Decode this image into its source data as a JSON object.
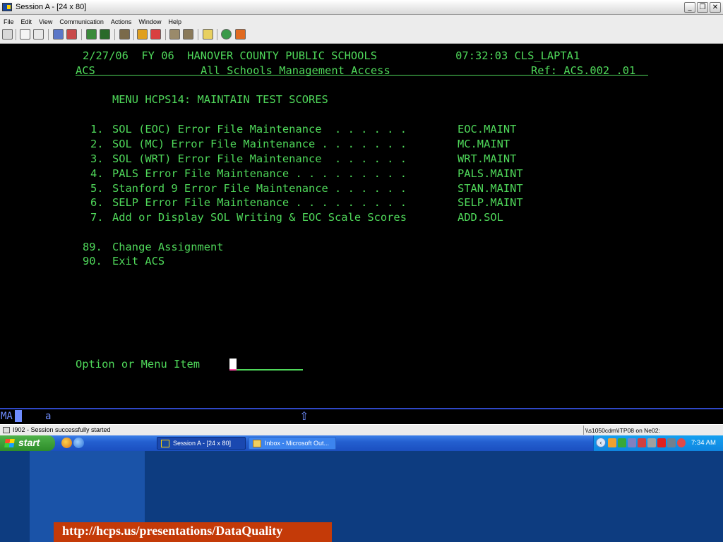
{
  "window": {
    "title": "Session A - [24 x 80]",
    "buttons": [
      "_",
      "❐",
      "✕"
    ]
  },
  "menubar": [
    "File",
    "Edit",
    "View",
    "Communication",
    "Actions",
    "Window",
    "Help"
  ],
  "terminal": {
    "header": {
      "line1": "2/27/06  FY 06  HANOVER COUNTY PUBLIC SCHOOLS            07:32:03 CLS_LAPTA1",
      "app": "ACS",
      "subtitle": "All Schools Management Access",
      "ref": "Ref: ACS.002 .01"
    },
    "menu_title": "MENU HCPS14: MAINTAIN TEST SCORES",
    "items": [
      {
        "num": "1.",
        "label": "SOL (EOC) Error File Maintenance  . . . . . .",
        "code": "EOC.MAINT"
      },
      {
        "num": "2.",
        "label": "SOL (MC) Error File Maintenance . . . . . . .",
        "code": "MC.MAINT"
      },
      {
        "num": "3.",
        "label": "SOL (WRT) Error File Maintenance  . . . . . .",
        "code": "WRT.MAINT"
      },
      {
        "num": "4.",
        "label": "PALS Error File Maintenance . . . . . . . . .",
        "code": "PALS.MAINT"
      },
      {
        "num": "5.",
        "label": "Stanford 9 Error File Maintenance . . . . . .",
        "code": "STAN.MAINT"
      },
      {
        "num": "6.",
        "label": "SELP Error File Maintenance . . . . . . . . .",
        "code": "SELP.MAINT"
      },
      {
        "num": "7.",
        "label": "Add or Display SOL Writing & EOC Scale Scores",
        "code": "ADD.SOL"
      }
    ],
    "extra_items": [
      {
        "num": "89.",
        "label": "Change Assignment"
      },
      {
        "num": "90.",
        "label": "Exit ACS"
      }
    ],
    "prompt": "Option or Menu Item"
  },
  "oia": {
    "ma": "MA",
    "indicator": "a",
    "arrow": "⇧"
  },
  "statusbar": {
    "message": "I902 - Session successfully started",
    "path": "\\\\s1050cdm\\ITP08 on Ne02:"
  },
  "taskbar": {
    "start": "start",
    "tasks": [
      {
        "label": "Session A - [24 x 80]"
      },
      {
        "label": "Inbox - Microsoft Out..."
      }
    ],
    "clock": "7:34 AM"
  },
  "slide": {
    "url": "http://hcps.us/presentations/DataQuality"
  },
  "colors": {
    "terminal_text": "#4fd85a",
    "terminal_bg": "#000000",
    "oia_text": "#6f8dff",
    "taskbar": "#2460d0",
    "slide_bg": "#0d3c80",
    "url_band": "#c43a08"
  }
}
